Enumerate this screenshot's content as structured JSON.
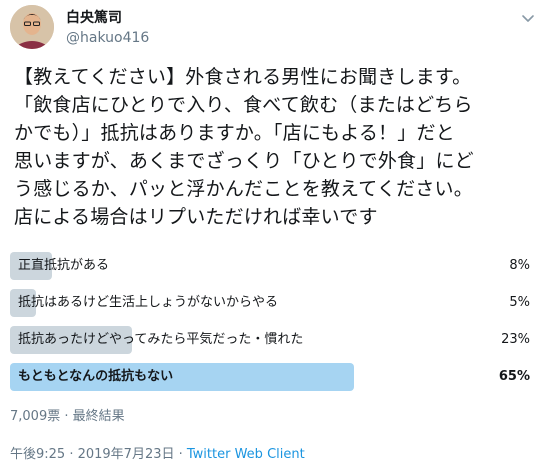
{
  "author": {
    "display_name": "白央篤司",
    "handle": "@hakuo416"
  },
  "tweet": {
    "text": "【教えてください】外食される男性にお聞きします。\n「飲食店にひとりで入り、食べて飲む（またはどちら\nかでも）」抵抗はありますか。「店にもよる！」だと\n思いますが、あくまでざっくり「ひとりで外食」にど\nう感じるか、パッと浮かんだことを教えてください。\n店による場合はリプいただければ幸いです"
  },
  "poll": {
    "options": [
      {
        "label": "正直抵抗がある",
        "percent": 8,
        "percent_label": "8%",
        "winner": false
      },
      {
        "label": "抵抗はあるけど生活上しょうがないからやる",
        "percent": 5,
        "percent_label": "5%",
        "winner": false
      },
      {
        "label": "抵抗あったけどやってみたら平気だった・慣れた",
        "percent": 23,
        "percent_label": "23%",
        "winner": false
      },
      {
        "label": "もともとなんの抵抗もない",
        "percent": 65,
        "percent_label": "65%",
        "winner": true
      }
    ],
    "meta": "7,009票 · 最終結果"
  },
  "footer": {
    "timestamp": "午後9:25 · 2019年7月23日 · ",
    "client": "Twitter Web Client"
  },
  "colors": {
    "bar": "#ccd6dd",
    "winner_bar": "#a6d4f2",
    "link": "#1b95e0",
    "muted": "#657786"
  },
  "icons": {
    "caret": "chevron-down-icon",
    "avatar": "user-avatar"
  }
}
